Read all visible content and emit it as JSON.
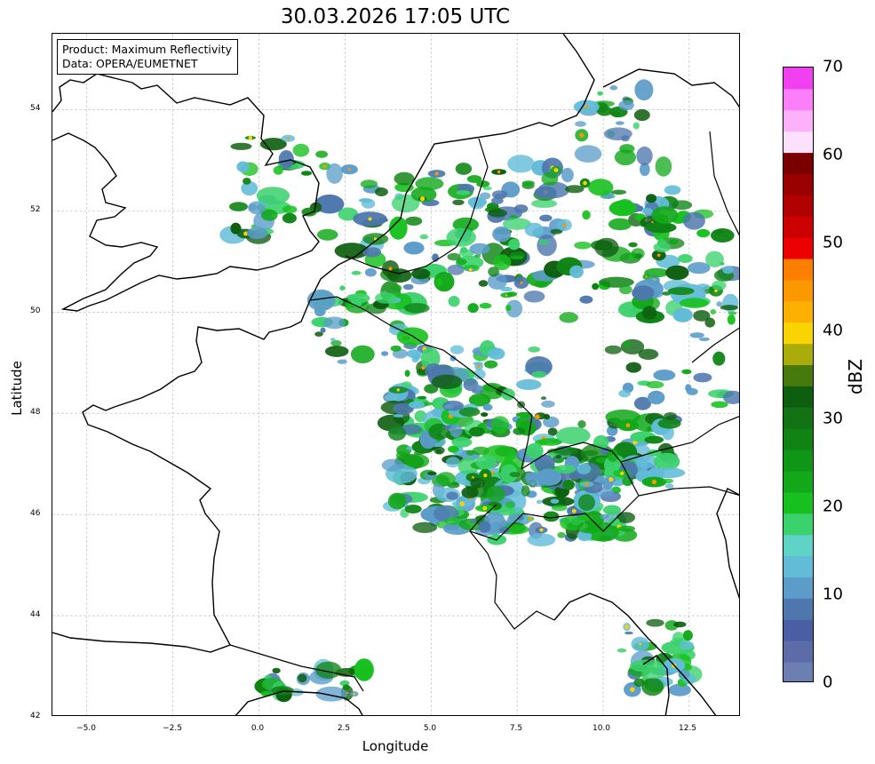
{
  "title": "30.03.2026 17:05 UTC",
  "info": {
    "product_line": "Product: Maximum Reflectivity",
    "data_line": "Data: OPERA/EUMETNET"
  },
  "axes": {
    "xlabel": "Longitude",
    "ylabel": "Latitude",
    "xlim": [
      -6,
      14
    ],
    "ylim": [
      42,
      55.5
    ],
    "xticks": [
      "−5.0",
      "−2.5",
      "0.0",
      "2.5",
      "5.0",
      "7.5",
      "10.0",
      "12.5"
    ],
    "yticks": [
      "42",
      "44",
      "46",
      "48",
      "50",
      "52",
      "54"
    ],
    "grid": true
  },
  "colorbar": {
    "label": "dBZ",
    "ticks": [
      "0",
      "10",
      "20",
      "30",
      "40",
      "50",
      "60",
      "70"
    ],
    "range": [
      0,
      70
    ],
    "colors": [
      "#6b7fb0",
      "#5b6ca8",
      "#4a5fa3",
      "#4d77ad",
      "#5b9cc9",
      "#62bcd8",
      "#5fd3c6",
      "#3bd16c",
      "#17c01e",
      "#12a81a",
      "#0f9616",
      "#0f8415",
      "#127214",
      "#0d5e0f",
      "#467a0c",
      "#a9ac0a",
      "#fad400",
      "#fcb100",
      "#fc9800",
      "#fc7f00",
      "#ec0000",
      "#cc0000",
      "#b00000",
      "#9a0000",
      "#7a0000",
      "#fde0fb",
      "#fcb1f9",
      "#fc7ef8",
      "#f040ef"
    ]
  },
  "regions": [
    "Great Britain",
    "France",
    "Belgium",
    "Netherlands",
    "Germany",
    "Switzerland",
    "Italy",
    "Corsica",
    "Spain"
  ]
}
